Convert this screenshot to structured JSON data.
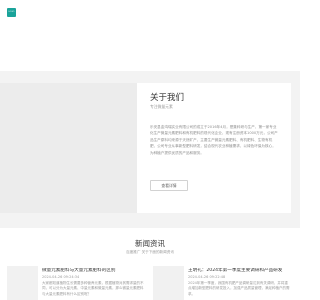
{
  "header": {
    "logo_text": "LOGO"
  },
  "about": {
    "title": "关于我们",
    "subtitle": "专注微量元素",
    "text": "乐安县金鸿瑞实业有限公司的成立于2016年4月，是集科研与生产、第一家专业化生产微量元素肥料和有机肥料的现代化企业，现有注册资本1000万元，公司产品生产原料均来源于天然矿产，主要生产微量元素肥料、有机肥料、生物有机肥，公司专业从事新型肥料研发，结合现代农业种植需求，以绿色环保为核心，为种植户提供优质的产品和服务。",
    "button_label": "查看详情"
  },
  "news": {
    "title": "新闻资讯",
    "subtitle": "百度推广 关于下面的新闻资讯",
    "items": [
      {
        "headline": "微量元素肥料与大量元素肥料的区别",
        "date": "2024-04-26 09:24:34",
        "excerpt": "大家都知道植物生长需要多种营养元素，根据植物对其需求量的不同，可以分为大量元素、中量元素和微量元素，那么微量元素肥料与大量元素肥料有什么区别呢？"
      },
      {
        "headline": "王明礼：2024年第一季度主要调研和产品研发",
        "date": "2024-04-26 09:22:48",
        "excerpt": "2024年第一季度，我国有机肥产品调研量达到有关调研，并将重点增加新型肥料的研发投入，加强产品质量管理，满足种植户的需求。"
      }
    ]
  }
}
